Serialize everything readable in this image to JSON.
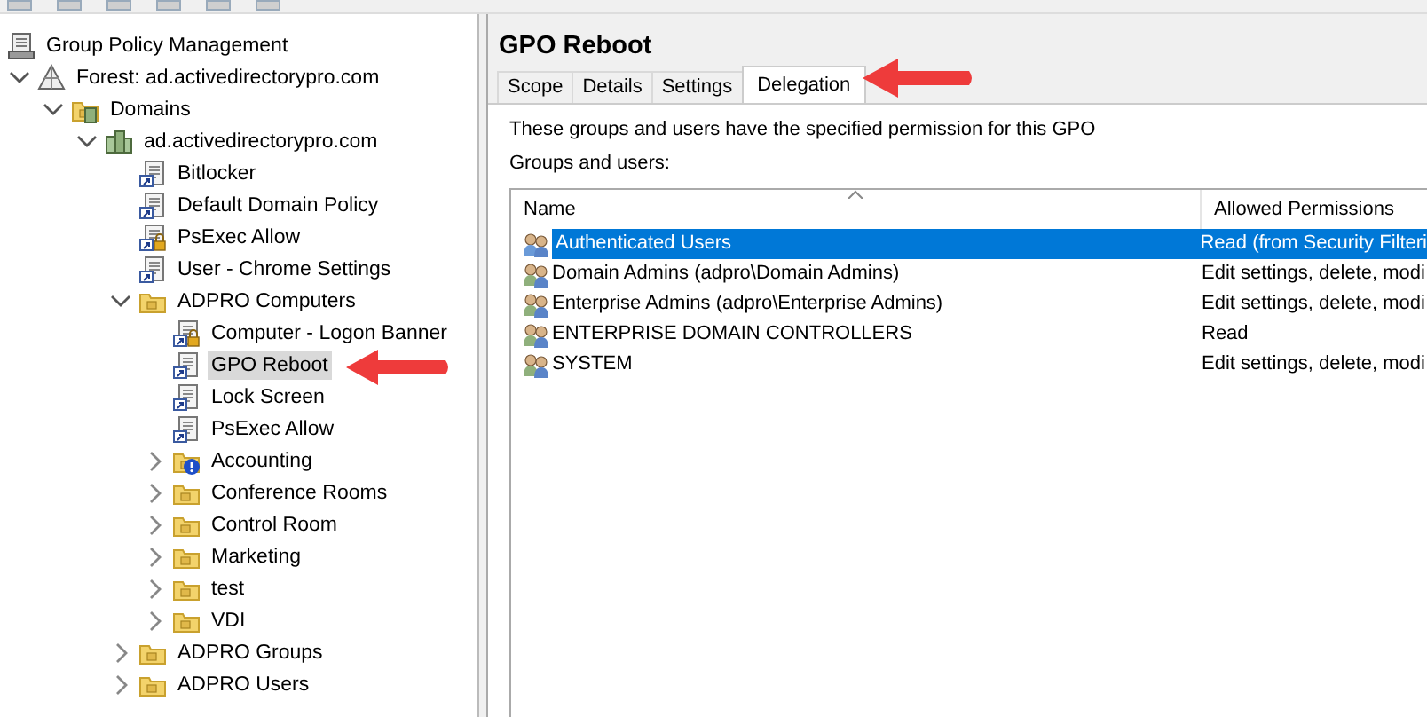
{
  "tree": [
    {
      "label": "Group Policy Management",
      "kind": "root",
      "selected": false,
      "children": [
        {
          "label": "Forest: ad.activedirectorypro.com",
          "kind": "forest",
          "expanded": true,
          "selected": false,
          "children": [
            {
              "label": "Domains",
              "kind": "domains",
              "expanded": true,
              "selected": false,
              "children": [
                {
                  "label": "ad.activedirectorypro.com",
                  "kind": "domain",
                  "expanded": true,
                  "selected": false,
                  "children": [
                    {
                      "label": "Bitlocker",
                      "kind": "gpo",
                      "selected": false
                    },
                    {
                      "label": "Default Domain Policy",
                      "kind": "gpo",
                      "selected": false
                    },
                    {
                      "label": "PsExec Allow",
                      "kind": "gpo-locked",
                      "selected": false
                    },
                    {
                      "label": "User - Chrome Settings",
                      "kind": "gpo",
                      "selected": false
                    },
                    {
                      "label": "ADPRO Computers",
                      "kind": "ou",
                      "expanded": true,
                      "selected": false,
                      "children": [
                        {
                          "label": "Computer - Logon Banner",
                          "kind": "gpo-locked",
                          "selected": false
                        },
                        {
                          "label": "GPO Reboot",
                          "kind": "gpo",
                          "selected": true
                        },
                        {
                          "label": "Lock Screen",
                          "kind": "gpo",
                          "selected": false
                        },
                        {
                          "label": "PsExec Allow",
                          "kind": "gpo",
                          "selected": false
                        },
                        {
                          "label": "Accounting",
                          "kind": "ou-warning",
                          "expanded": false,
                          "selected": false
                        },
                        {
                          "label": "Conference Rooms",
                          "kind": "ou",
                          "expanded": false,
                          "selected": false
                        },
                        {
                          "label": "Control Room",
                          "kind": "ou",
                          "expanded": false,
                          "selected": false
                        },
                        {
                          "label": "Marketing",
                          "kind": "ou",
                          "expanded": false,
                          "selected": false
                        },
                        {
                          "label": "test",
                          "kind": "ou",
                          "expanded": false,
                          "selected": false
                        },
                        {
                          "label": "VDI",
                          "kind": "ou",
                          "expanded": false,
                          "selected": false
                        }
                      ]
                    },
                    {
                      "label": "ADPRO Groups",
                      "kind": "ou",
                      "expanded": false,
                      "selected": false
                    },
                    {
                      "label": "ADPRO Users",
                      "kind": "ou",
                      "expanded": false,
                      "selected": false
                    }
                  ]
                }
              ]
            }
          ]
        }
      ]
    }
  ],
  "details": {
    "title": "GPO Reboot",
    "tabs": [
      {
        "label": "Scope",
        "selected": false
      },
      {
        "label": "Details",
        "selected": false
      },
      {
        "label": "Settings",
        "selected": false
      },
      {
        "label": "Delegation",
        "selected": true
      }
    ],
    "description": "These groups and users have the specified permission for this GPO",
    "list_label": "Groups and users:",
    "columns": [
      "Name",
      "Allowed Permissions"
    ],
    "rows": [
      {
        "name": "Authenticated Users",
        "permissions": "Read (from Security Filteri",
        "selected": true
      },
      {
        "name": "Domain Admins (adpro\\Domain Admins)",
        "permissions": "Edit settings, delete, modi",
        "selected": false
      },
      {
        "name": "Enterprise Admins (adpro\\Enterprise Admins)",
        "permissions": "Edit settings, delete, modi",
        "selected": false
      },
      {
        "name": "ENTERPRISE DOMAIN CONTROLLERS",
        "permissions": "Read",
        "selected": false
      },
      {
        "name": "SYSTEM",
        "permissions": "Edit settings, delete, modi",
        "selected": false
      }
    ]
  }
}
